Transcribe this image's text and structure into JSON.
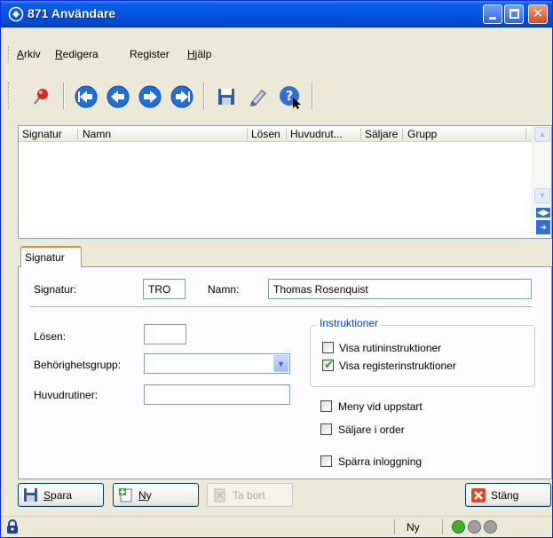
{
  "window": {
    "title": "871 Användare",
    "app_icon": "logo-icon"
  },
  "menu": {
    "items": [
      "Arkiv",
      "Redigera",
      "Register",
      "Hjälp"
    ],
    "mnemonics": [
      "A",
      "R",
      "",
      "H"
    ]
  },
  "toolbar": {
    "buttons": [
      "search-pin-icon",
      "first-record-icon",
      "prev-record-icon",
      "next-record-icon",
      "last-record-icon",
      "save-icon",
      "edit-icon",
      "help-icon"
    ]
  },
  "list": {
    "columns": [
      "Signatur",
      "Namn",
      "Lösen",
      "Huvudrut...",
      "Säljare",
      "Grupp"
    ],
    "rows": []
  },
  "tab": {
    "label": "Signatur"
  },
  "form": {
    "signatur_label": "Signatur:",
    "signatur_value": "TRO",
    "namn_label": "Namn:",
    "namn_value": "Thomas Rosenquist",
    "losen_label": "Lösen:",
    "losen_value": "",
    "group_label": "Behörighetsgrupp:",
    "group_value": "",
    "routines_label": "Huvudrutiner:",
    "routines_value": ""
  },
  "instructions": {
    "title": "Instruktioner",
    "visa_rutin_label": "Visa rutininstruktioner",
    "visa_rutin_checked": false,
    "visa_register_label": "Visa registerinstruktioner",
    "visa_register_checked": true
  },
  "options": {
    "meny_label": "Meny vid uppstart",
    "meny_checked": false,
    "saljare_label": "Säljare i order",
    "saljare_checked": false,
    "sparra_label": "Spärra inloggning",
    "sparra_checked": false
  },
  "buttons": {
    "save": "Spara",
    "save_mnemonic": "S",
    "new": "Ny",
    "new_mnemonic": "N",
    "delete": "Ta bort",
    "close": "Stäng"
  },
  "status": {
    "mode": "Ny",
    "led_colors": [
      "#3FAE2A",
      "#9E9E9E",
      "#9E9E9E"
    ]
  },
  "colors": {
    "titlebar": "#0054E3",
    "accent_tab": "#E68B2C",
    "groupbox_title": "#0046D5"
  }
}
